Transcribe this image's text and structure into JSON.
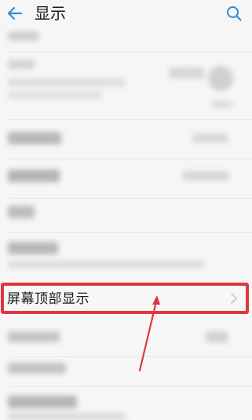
{
  "header": {
    "title": "显示",
    "back_icon": "back-arrow-icon",
    "search_icon": "search-icon"
  },
  "highlighted_item": {
    "label": "屏幕顶部显示",
    "chevron_icon": "chevron-right-icon"
  },
  "colors": {
    "accent": "#2f8fd8",
    "highlight_border": "#e2353f",
    "annotation_arrow": "#e2353f",
    "background": "#f6f6f6"
  }
}
